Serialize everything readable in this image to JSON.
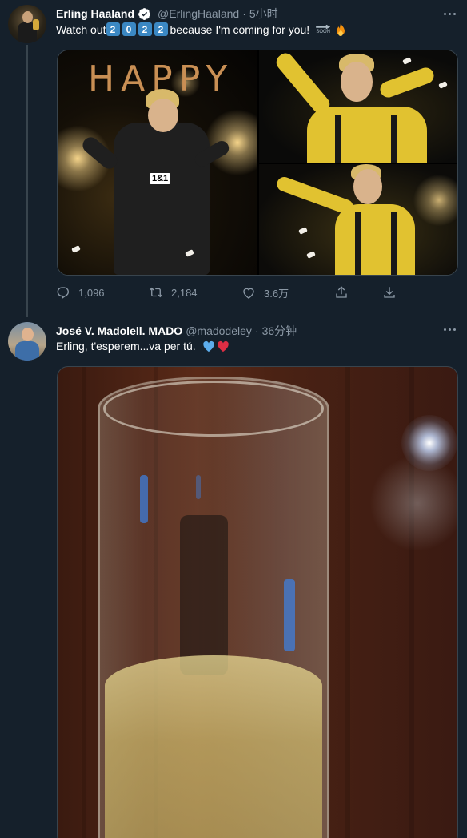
{
  "tweets": [
    {
      "author_name": "Erling Haaland",
      "verified": true,
      "handle": "@ErlingHaaland",
      "separator": "·",
      "time": "5小时",
      "text_before": "Watch out",
      "year_digits": [
        "2",
        "0",
        "2",
        "2"
      ],
      "text_after": "because I'm coming for you!",
      "soon_label": "SOON",
      "image_text": "HAPPY",
      "jersey_sponsor": "1&1",
      "actions": {
        "reply_count": "1,096",
        "retweet_count": "2,184",
        "like_count": "3.6万"
      }
    },
    {
      "author_name": "José V. Madolell. MADO",
      "handle": "@madodeley",
      "separator": "·",
      "time": "36分钟",
      "text": "Erling, t'esperem...va per tú."
    }
  ],
  "colors": {
    "background": "#15202b",
    "text_primary": "#ffffff",
    "text_secondary": "#8b98a5",
    "divider": "#38444d",
    "verified_blue": "#1d9bf0"
  },
  "icons": [
    "verified-badge-icon",
    "more-icon",
    "reply-icon",
    "retweet-icon",
    "like-icon",
    "share-icon",
    "download-icon",
    "soon-arrow-icon",
    "fire-icon",
    "blue-heart-icon",
    "red-heart-icon"
  ]
}
